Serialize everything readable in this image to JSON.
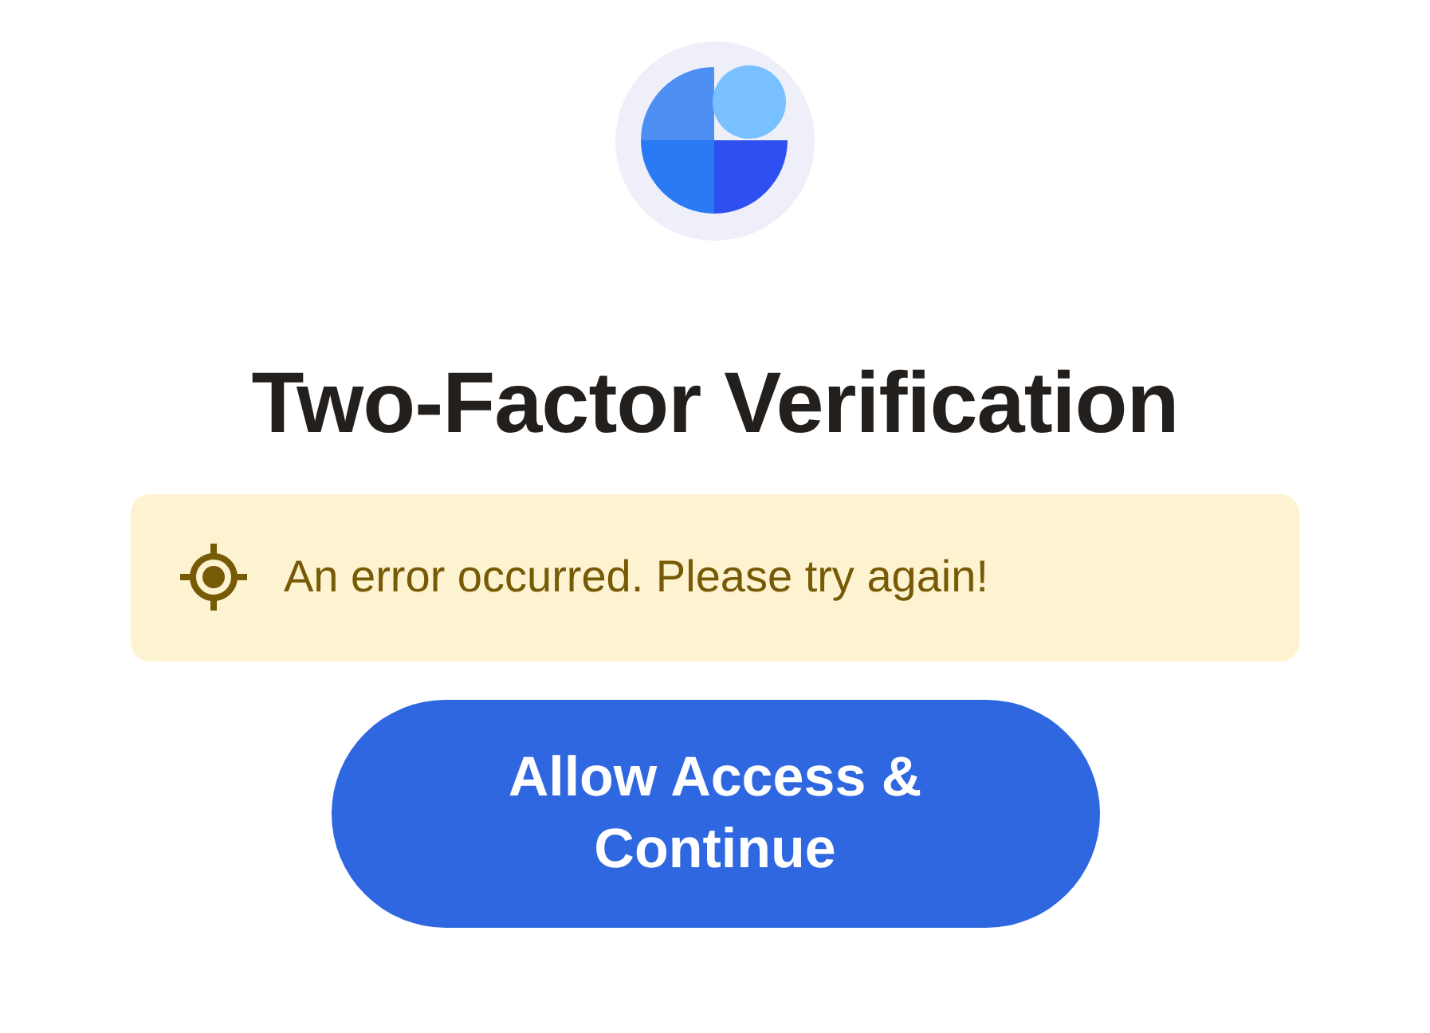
{
  "title": "Two-Factor Verification",
  "alert": {
    "kind": "warning",
    "text": "An error occurred. Please try again!"
  },
  "button": {
    "label": "Allow Access & Continue"
  }
}
